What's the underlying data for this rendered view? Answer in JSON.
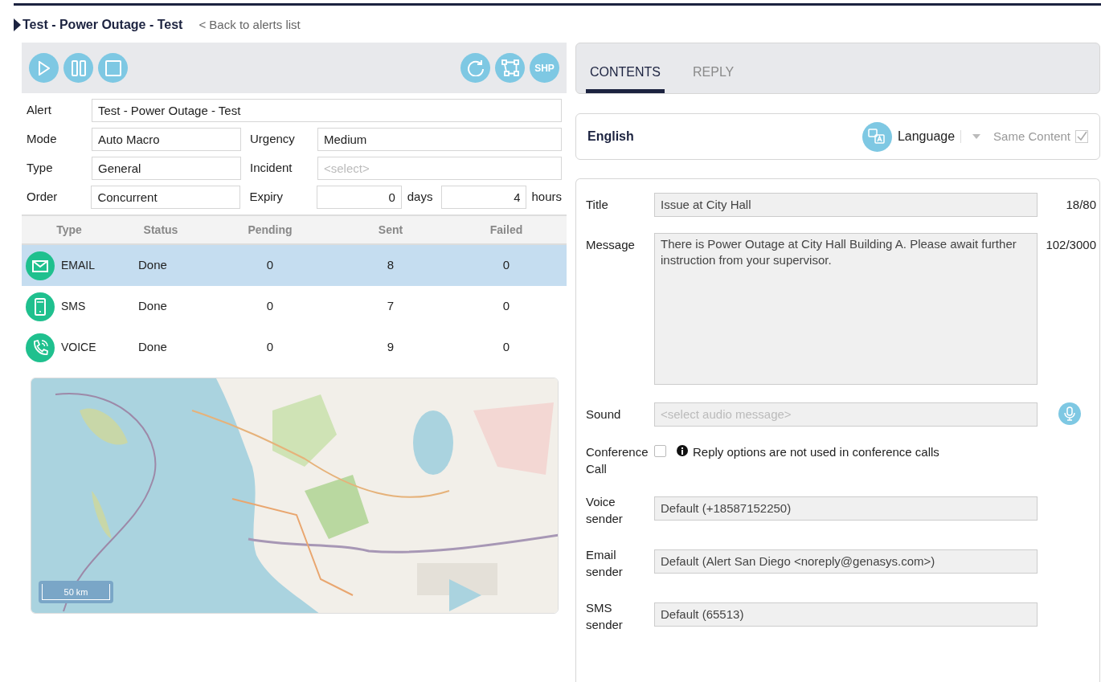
{
  "header": {
    "title": "Test - Power Outage - Test",
    "back_link": "< Back to alerts list"
  },
  "toolbar": {
    "left_buttons": [
      {
        "kind": "play"
      },
      {
        "kind": "pause"
      },
      {
        "kind": "stop"
      }
    ],
    "right_buttons": [
      {
        "kind": "refresh"
      },
      {
        "kind": "polygon"
      },
      {
        "kind": "text",
        "label": "SHP"
      }
    ]
  },
  "alert_form": {
    "alert": {
      "label": "Alert",
      "value": "Test - Power Outage - Test"
    },
    "mode": {
      "label": "Mode",
      "value": "Auto Macro"
    },
    "urgency": {
      "label": "Urgency",
      "value": "Medium"
    },
    "type": {
      "label": "Type",
      "value": "General"
    },
    "incident": {
      "label": "Incident",
      "placeholder": "<select>"
    },
    "order": {
      "label": "Order",
      "value": "Concurrent"
    },
    "expiry": {
      "label": "Expiry",
      "days": "0",
      "days_unit": "days",
      "hours": "4",
      "hours_unit": "hours"
    }
  },
  "channels_table": {
    "columns": [
      "Type",
      "Status",
      "Pending",
      "Sent",
      "Failed"
    ],
    "rows": [
      {
        "kind": "email",
        "type": "EMAIL",
        "status": "Done",
        "pending": "0",
        "sent": "8",
        "failed": "0",
        "selected": true
      },
      {
        "kind": "sms",
        "type": "SMS",
        "status": "Done",
        "pending": "0",
        "sent": "7",
        "failed": "0",
        "selected": false
      },
      {
        "kind": "voice",
        "type": "VOICE",
        "status": "Done",
        "pending": "0",
        "sent": "9",
        "failed": "0",
        "selected": false
      }
    ]
  },
  "map": {
    "kind": "picture",
    "scale_label": "50 km"
  },
  "tabs": [
    {
      "label": "CONTENTS",
      "selected": true
    },
    {
      "label": "REPLY",
      "selected": false
    }
  ],
  "language_bar": {
    "language": "English",
    "language_button": "Language",
    "same_content": {
      "label": "Same Content",
      "checked": true,
      "disabled": true
    }
  },
  "content_form": {
    "title": {
      "label": "Title",
      "value": "Issue at City Hall",
      "counter": "18/80"
    },
    "message": {
      "label": "Message",
      "value": "There is Power Outage at City Hall Building A. Please await further instruction from your supervisor.",
      "counter": "102/3000"
    },
    "sound": {
      "label": "Sound",
      "placeholder": "<select audio message>"
    },
    "conference_call": {
      "label": "Conference Call",
      "checked": false,
      "note": "Reply options are not used in conference calls"
    },
    "senders": [
      {
        "label": "Voice sender",
        "value": "Default (+18587152250)"
      },
      {
        "label": "Email sender",
        "value": "Default (Alert San Diego <noreply@genasys.com>)"
      },
      {
        "label": "SMS sender",
        "value": "Default (65513)"
      }
    ]
  }
}
